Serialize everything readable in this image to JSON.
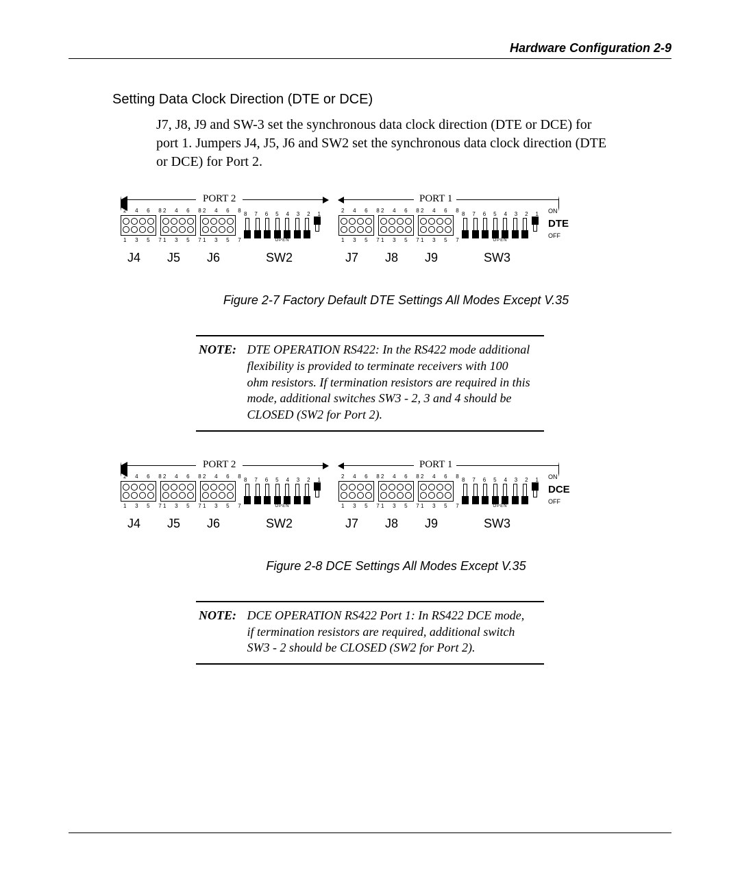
{
  "header": {
    "running": "Hardware Configuration   2-9"
  },
  "section": {
    "title": "Setting Data Clock Direction (DTE or DCE)",
    "para": "J7, J8, J9 and SW-3 set the synchronous data clock direction (DTE or DCE) for port 1.  Jumpers J4, J5, J6 and SW2 set the synchronous data clock direction (DTE or DCE) for Port 2."
  },
  "figure1": {
    "caption": "Figure 2-7 Factory Default DTE Settings All Modes Except V.35",
    "port2_label": "PORT 2",
    "port1_label": "PORT 1",
    "labels": {
      "j4": "J4",
      "j5": "J5",
      "j6": "J6",
      "sw2": "SW2",
      "j7": "J7",
      "j8": "J8",
      "j9": "J9",
      "sw3": "SW3"
    },
    "jumper_top_nums": [
      "2",
      "4",
      "6",
      "8"
    ],
    "jumper_bot_nums": [
      "1",
      "3",
      "5",
      "7"
    ],
    "dip_nums": [
      "8",
      "7",
      "6",
      "5",
      "4",
      "3",
      "2",
      "1"
    ],
    "side": {
      "top": "ON",
      "mid": "DTE",
      "bot": "OFF"
    },
    "open": "OPEN",
    "dip_sw1_closed": true
  },
  "note1": {
    "label": "NOTE:",
    "text": "DTE OPERATION RS422:  In the RS422 mode additional flexibility is provided to terminate receivers with 100 ohm resistors. If termination resistors are required in this mode, additional switches SW3 - 2, 3 and 4 should be CLOSED (SW2 for Port 2)."
  },
  "figure2": {
    "caption": "Figure 2-8 DCE Settings All Modes Except V.35",
    "port2_label": "PORT 2",
    "port1_label": "PORT 1",
    "labels": {
      "j4": "J4",
      "j5": "J5",
      "j6": "J6",
      "sw2": "SW2",
      "j7": "J7",
      "j8": "J8",
      "j9": "J9",
      "sw3": "SW3"
    },
    "jumper_top_nums": [
      "2",
      "4",
      "6",
      "8"
    ],
    "jumper_bot_nums": [
      "1",
      "3",
      "5",
      "7"
    ],
    "dip_nums": [
      "8",
      "7",
      "6",
      "5",
      "4",
      "3",
      "2",
      "1"
    ],
    "side": {
      "top": "ON",
      "mid": "DCE",
      "bot": "OFF"
    },
    "open": "OPEN",
    "dip_sw1_closed": true
  },
  "note2": {
    "label": "NOTE:",
    "text": "DCE OPERATION RS422 Port 1:  In RS422 DCE mode, if termination resistors are required, additional switch SW3 - 2 should be CLOSED (SW2 for Port 2)."
  }
}
